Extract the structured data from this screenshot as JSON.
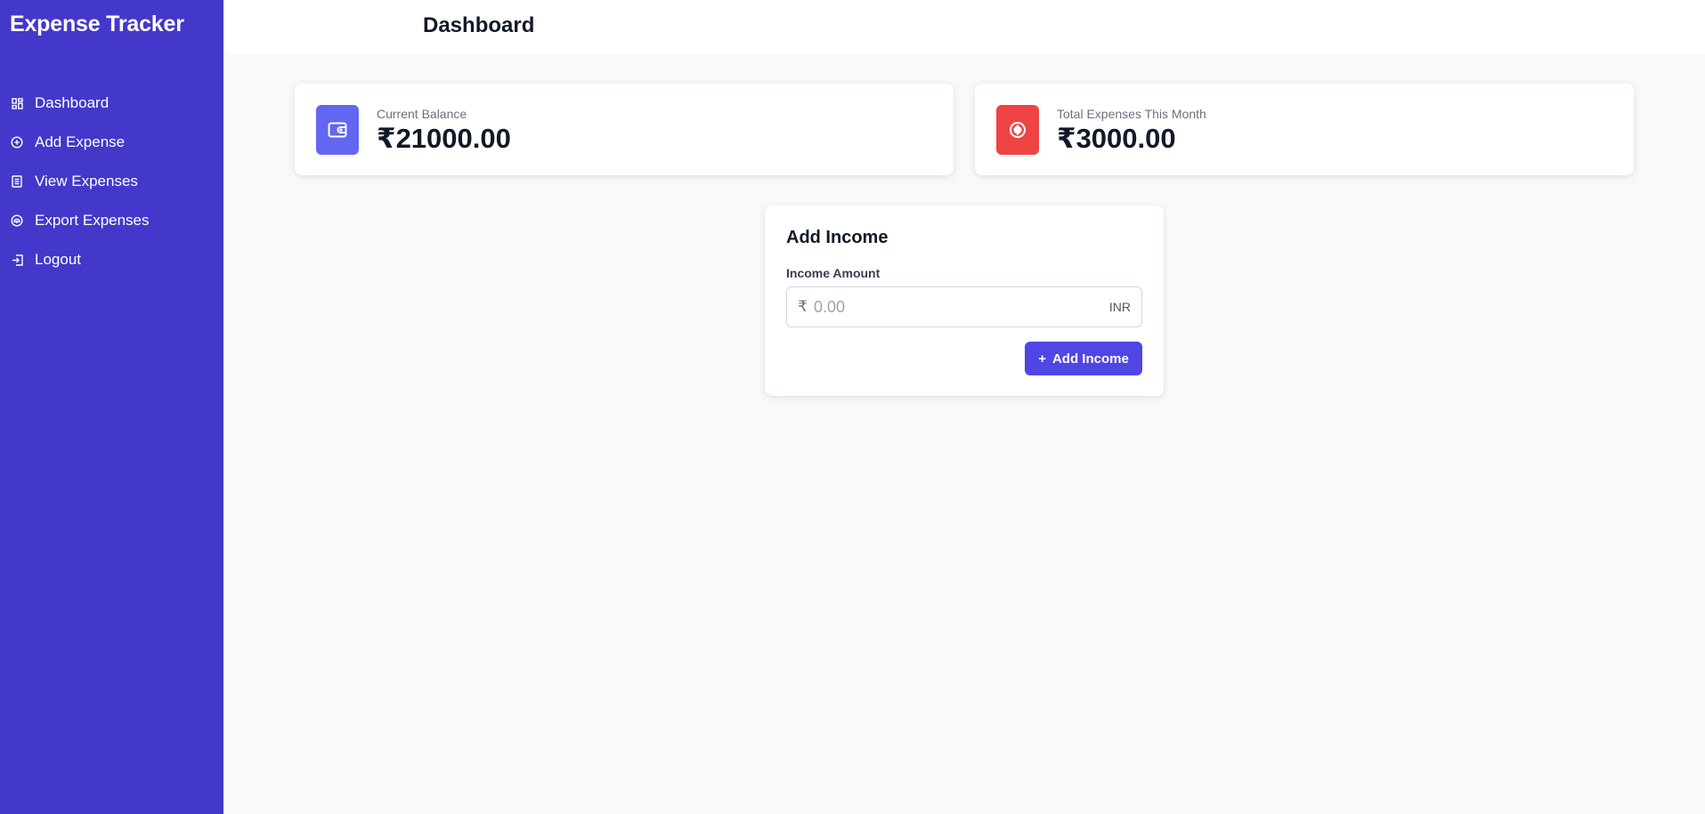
{
  "app": {
    "title": "Expense Tracker"
  },
  "sidebar": {
    "items": [
      {
        "label": "Dashboard",
        "icon": "dashboard-grid-icon"
      },
      {
        "label": "Add Expense",
        "icon": "plus-circle-icon"
      },
      {
        "label": "View Expenses",
        "icon": "document-list-icon"
      },
      {
        "label": "Export Expenses",
        "icon": "cloud-download-icon"
      },
      {
        "label": "Logout",
        "icon": "logout-icon"
      }
    ],
    "background": "#4338ca"
  },
  "header": {
    "title": "Dashboard"
  },
  "stats": {
    "balance": {
      "label": "Current Balance",
      "value": "₹21000.00",
      "icon": "wallet-icon",
      "color": "#6366f1"
    },
    "expenses": {
      "label": "Total Expenses This Month",
      "value": "₹3000.00",
      "icon": "coin-icon",
      "color": "#ef4444"
    }
  },
  "income_form": {
    "title": "Add Income",
    "field_label": "Income Amount",
    "currency_symbol": "₹",
    "placeholder": "0.00",
    "value": "",
    "currency_code": "INR",
    "button_label": "Add Income",
    "button_color": "#4f46e5"
  }
}
